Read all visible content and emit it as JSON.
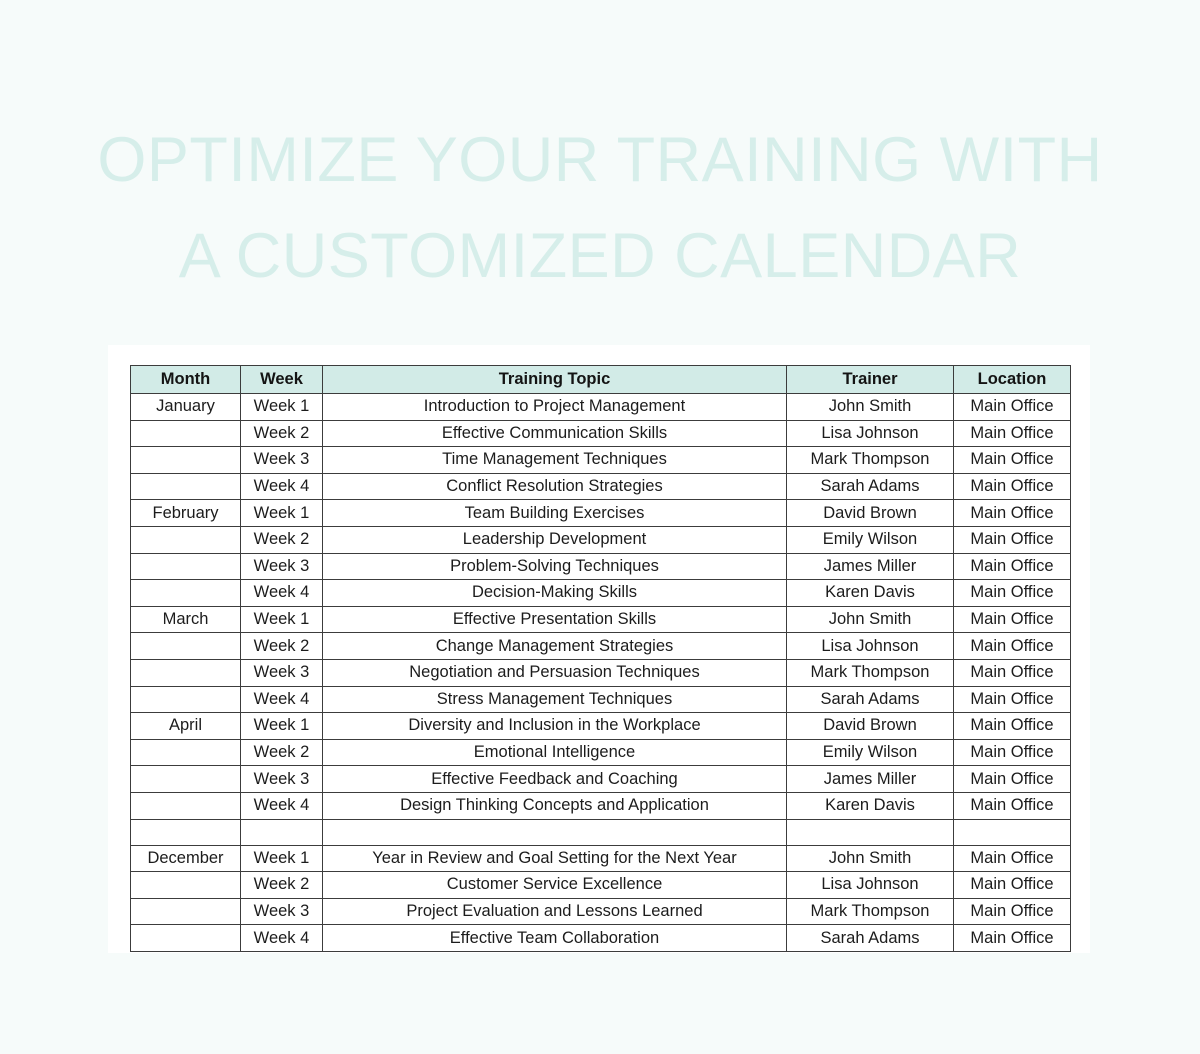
{
  "page": {
    "background_color": "#f6fbfa",
    "card_color": "#ffffff"
  },
  "headline": {
    "text": "OPTIMIZE YOUR TRAINING WITH\nA CUSTOMIZED CALENDAR",
    "color": "#d6eeea"
  },
  "table": {
    "header_background": "#d2ebe7",
    "border_color": "#3c3c3c",
    "columns": [
      {
        "key": "month",
        "label": "Month"
      },
      {
        "key": "week",
        "label": "Week"
      },
      {
        "key": "topic",
        "label": "Training Topic"
      },
      {
        "key": "trainer",
        "label": "Trainer"
      },
      {
        "key": "location",
        "label": "Location"
      }
    ],
    "rows": [
      {
        "month": "January",
        "week": "Week 1",
        "topic": "Introduction to Project Management",
        "trainer": "John Smith",
        "location": "Main Office"
      },
      {
        "month": "",
        "week": "Week 2",
        "topic": "Effective Communication Skills",
        "trainer": "Lisa Johnson",
        "location": "Main Office"
      },
      {
        "month": "",
        "week": "Week 3",
        "topic": "Time Management Techniques",
        "trainer": "Mark Thompson",
        "location": "Main Office"
      },
      {
        "month": "",
        "week": "Week 4",
        "topic": "Conflict Resolution Strategies",
        "trainer": "Sarah Adams",
        "location": "Main Office"
      },
      {
        "month": "February",
        "week": "Week 1",
        "topic": "Team Building Exercises",
        "trainer": "David Brown",
        "location": "Main Office"
      },
      {
        "month": "",
        "week": "Week 2",
        "topic": "Leadership Development",
        "trainer": "Emily Wilson",
        "location": "Main Office"
      },
      {
        "month": "",
        "week": "Week 3",
        "topic": "Problem-Solving Techniques",
        "trainer": "James Miller",
        "location": "Main Office"
      },
      {
        "month": "",
        "week": "Week 4",
        "topic": "Decision-Making Skills",
        "trainer": "Karen Davis",
        "location": "Main Office"
      },
      {
        "month": "March",
        "week": "Week 1",
        "topic": "Effective Presentation Skills",
        "trainer": "John Smith",
        "location": "Main Office"
      },
      {
        "month": "",
        "week": "Week 2",
        "topic": "Change Management Strategies",
        "trainer": "Lisa Johnson",
        "location": "Main Office"
      },
      {
        "month": "",
        "week": "Week 3",
        "topic": "Negotiation and Persuasion Techniques",
        "trainer": "Mark Thompson",
        "location": "Main Office"
      },
      {
        "month": "",
        "week": "Week 4",
        "topic": "Stress Management Techniques",
        "trainer": "Sarah Adams",
        "location": "Main Office"
      },
      {
        "month": "April",
        "week": "Week 1",
        "topic": "Diversity and Inclusion in the Workplace",
        "trainer": "David Brown",
        "location": "Main Office"
      },
      {
        "month": "",
        "week": "Week 2",
        "topic": "Emotional Intelligence",
        "trainer": "Emily Wilson",
        "location": "Main Office"
      },
      {
        "month": "",
        "week": "Week 3",
        "topic": "Effective Feedback and Coaching",
        "trainer": "James Miller",
        "location": "Main Office"
      },
      {
        "month": "",
        "week": "Week 4",
        "topic": "Design Thinking Concepts and Application",
        "trainer": "Karen Davis",
        "location": "Main Office"
      },
      {
        "month": "",
        "week": "",
        "topic": "",
        "trainer": "",
        "location": ""
      },
      {
        "month": "December",
        "week": "Week 1",
        "topic": "Year in Review and Goal Setting for the Next Year",
        "trainer": "John Smith",
        "location": "Main Office"
      },
      {
        "month": "",
        "week": "Week 2",
        "topic": "Customer Service Excellence",
        "trainer": "Lisa Johnson",
        "location": "Main Office"
      },
      {
        "month": "",
        "week": "Week 3",
        "topic": "Project Evaluation and Lessons Learned",
        "trainer": "Mark Thompson",
        "location": "Main Office"
      },
      {
        "month": "",
        "week": "Week 4",
        "topic": "Effective Team Collaboration",
        "trainer": "Sarah Adams",
        "location": "Main Office"
      }
    ]
  }
}
